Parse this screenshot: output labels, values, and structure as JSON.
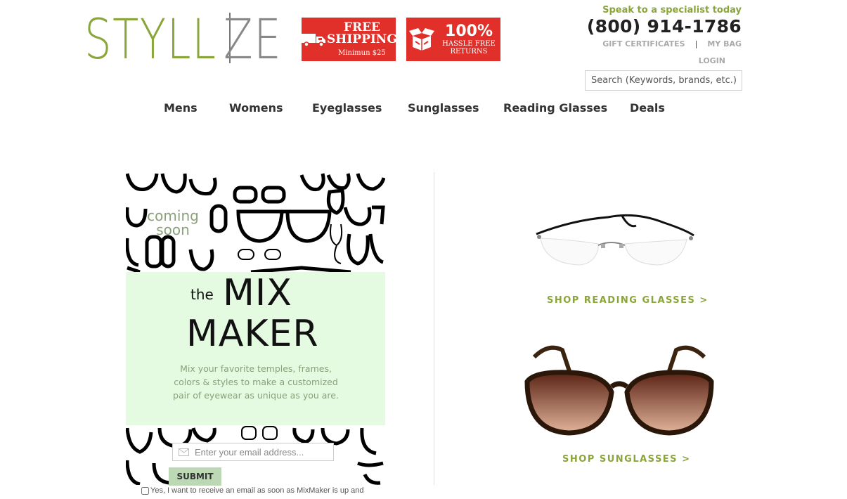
{
  "header": {
    "logo_part1": "STYLL",
    "logo_part2": "ZE",
    "badge_shipping": {
      "title": "FREE SHIPPING",
      "subtitle": "Minimun $25"
    },
    "badge_returns": {
      "title": "100%",
      "subtitle": "HASSLE FREE RETURNS"
    },
    "speak_text": "Speak to a specialist today",
    "phone": "(800) 914-1786",
    "links": {
      "gift": "GIFT CERTIFICATES",
      "separator": "|",
      "bag": "MY BAG",
      "login": "LOGIN"
    },
    "search_placeholder": "Search (Keywords, brands, etc.)"
  },
  "nav": [
    "Mens",
    "Womens",
    "Eyeglasses",
    "Sunglasses",
    "Reading Glasses",
    "Deals"
  ],
  "promo": {
    "coming_line1": "coming",
    "coming_line2": "soon",
    "the": "the",
    "mix": "MIX",
    "maker": "MAKER",
    "description": "Mix your favorite temples, frames, colors & styles to make a customized pair of eyewear as unique as you are.",
    "email_placeholder": "Enter your email address...",
    "submit_label": "SUBMIT",
    "optin_text": "Yes, I want to receive an email as soon as MixMaker is up and"
  },
  "shop": {
    "reading_link": "SHOP READING GLASSES >",
    "sunglasses_link": "SHOP SUNGLASSES >"
  },
  "colors": {
    "brand_green": "#8aa53a",
    "badge_red": "#e12f2a",
    "mix_panel_bg": "#e4fbe1",
    "submit_bg": "#bcd8b4"
  }
}
